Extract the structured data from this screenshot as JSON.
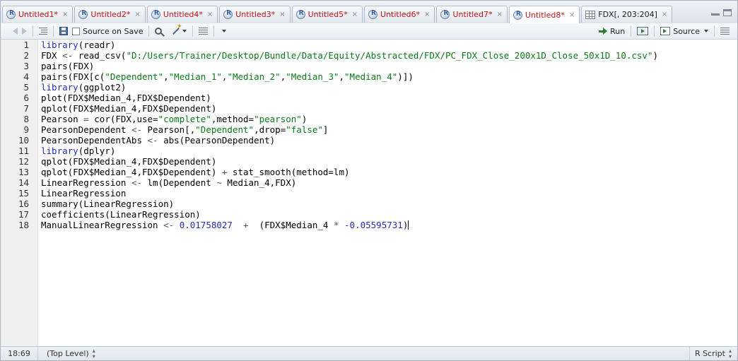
{
  "tabs": [
    {
      "label": "Untitled1*",
      "icon": "r-script-icon",
      "unsaved": true
    },
    {
      "label": "Untitled2*",
      "icon": "r-script-icon",
      "unsaved": true
    },
    {
      "label": "Untitled4*",
      "icon": "r-script-icon",
      "unsaved": true
    },
    {
      "label": "Untitled3*",
      "icon": "r-script-icon",
      "unsaved": true
    },
    {
      "label": "Untitled5*",
      "icon": "r-script-icon",
      "unsaved": true
    },
    {
      "label": "Untitled6*",
      "icon": "r-script-icon",
      "unsaved": true
    },
    {
      "label": "Untitled7*",
      "icon": "r-script-icon",
      "unsaved": true
    },
    {
      "label": "Untitled8*",
      "icon": "r-script-icon",
      "unsaved": true,
      "active": true
    },
    {
      "label": "FDX[, 203:204]",
      "icon": "data-grid-icon",
      "unsaved": false
    }
  ],
  "tab_close_glyph": "×",
  "toolbar": {
    "source_on_save_label": "Source on Save",
    "run_label": "Run",
    "source_label": "Source"
  },
  "editor": {
    "lines": [
      {
        "n": "1",
        "tokens": [
          {
            "t": "library",
            "c": "kw"
          },
          {
            "t": "(readr)"
          }
        ]
      },
      {
        "n": "2",
        "tokens": [
          {
            "t": "FDX "
          },
          {
            "t": "<-",
            "c": "op"
          },
          {
            "t": " read_csv("
          },
          {
            "t": "\"D:/Users/Trainer/Desktop/Bundle/Data/Equity/Abstracted/FDX/PC_FDX_Close_200x1D_Close_50x1D_10.csv\"",
            "c": "str"
          },
          {
            "t": ")"
          }
        ]
      },
      {
        "n": "3",
        "tokens": [
          {
            "t": "pairs(FDX)"
          }
        ]
      },
      {
        "n": "4",
        "tokens": [
          {
            "t": "pairs(FDX[c("
          },
          {
            "t": "\"Dependent\"",
            "c": "str"
          },
          {
            "t": ","
          },
          {
            "t": "\"Median_1\"",
            "c": "str"
          },
          {
            "t": ","
          },
          {
            "t": "\"Median_2\"",
            "c": "str"
          },
          {
            "t": ","
          },
          {
            "t": "\"Median_3\"",
            "c": "str"
          },
          {
            "t": ","
          },
          {
            "t": "\"Median_4\"",
            "c": "str"
          },
          {
            "t": ")])"
          }
        ]
      },
      {
        "n": "5",
        "tokens": [
          {
            "t": "library",
            "c": "kw"
          },
          {
            "t": "(ggplot2)"
          }
        ]
      },
      {
        "n": "6",
        "tokens": [
          {
            "t": "plot(FDX$Median_4,FDX$Dependent)"
          }
        ]
      },
      {
        "n": "7",
        "tokens": [
          {
            "t": "qplot(FDX$Median_4,FDX$Dependent)"
          }
        ]
      },
      {
        "n": "8",
        "tokens": [
          {
            "t": "Pearson "
          },
          {
            "t": "=",
            "c": "op"
          },
          {
            "t": " cor(FDX,use="
          },
          {
            "t": "\"complete\"",
            "c": "str"
          },
          {
            "t": ",method="
          },
          {
            "t": "\"pearson\"",
            "c": "str"
          },
          {
            "t": ")"
          }
        ]
      },
      {
        "n": "9",
        "tokens": [
          {
            "t": "PearsonDependent "
          },
          {
            "t": "<-",
            "c": "op"
          },
          {
            "t": " Pearson[,"
          },
          {
            "t": "\"Dependent\"",
            "c": "str"
          },
          {
            "t": ",drop="
          },
          {
            "t": "\"false\"",
            "c": "str"
          },
          {
            "t": "]"
          }
        ]
      },
      {
        "n": "10",
        "tokens": [
          {
            "t": "PearsonDependentAbs "
          },
          {
            "t": "<-",
            "c": "op"
          },
          {
            "t": " abs(PearsonDependent)"
          }
        ]
      },
      {
        "n": "11",
        "tokens": [
          {
            "t": "library",
            "c": "kw"
          },
          {
            "t": "(dplyr)"
          }
        ]
      },
      {
        "n": "12",
        "tokens": [
          {
            "t": "qplot(FDX$Median_4,FDX$Dependent)"
          }
        ]
      },
      {
        "n": "13",
        "tokens": [
          {
            "t": "qplot(FDX$Median_4,FDX$Dependent) "
          },
          {
            "t": "+",
            "c": "op"
          },
          {
            "t": " stat_smooth(method=lm)"
          }
        ]
      },
      {
        "n": "14",
        "tokens": [
          {
            "t": "LinearRegression "
          },
          {
            "t": "<-",
            "c": "op"
          },
          {
            "t": " lm(Dependent "
          },
          {
            "t": "~",
            "c": "op"
          },
          {
            "t": " Median_4,FDX)"
          }
        ]
      },
      {
        "n": "15",
        "tokens": [
          {
            "t": "LinearRegression"
          }
        ]
      },
      {
        "n": "16",
        "tokens": [
          {
            "t": "summary(LinearRegression)"
          }
        ]
      },
      {
        "n": "17",
        "tokens": [
          {
            "t": "coefficients(LinearRegression)"
          }
        ]
      },
      {
        "n": "18",
        "tokens": [
          {
            "t": "ManualLinearRegression "
          },
          {
            "t": "<-",
            "c": "op"
          },
          {
            "t": " "
          },
          {
            "t": "0.01758027",
            "c": "num"
          },
          {
            "t": "  "
          },
          {
            "t": "+",
            "c": "op"
          },
          {
            "t": "  (FDX$Median_4 "
          },
          {
            "t": "*",
            "c": "op"
          },
          {
            "t": " "
          },
          {
            "t": "-0.05595731",
            "c": "num"
          },
          {
            "t": ")"
          }
        ],
        "cursor": true
      }
    ]
  },
  "status": {
    "position": "18:69",
    "scope": "(Top Level)",
    "file_type": "R Script"
  },
  "colors": {
    "tab_text": "#c3141a",
    "keyword": "#1f2fb8",
    "string": "#0a7a17",
    "number": "#1f2fb8"
  }
}
